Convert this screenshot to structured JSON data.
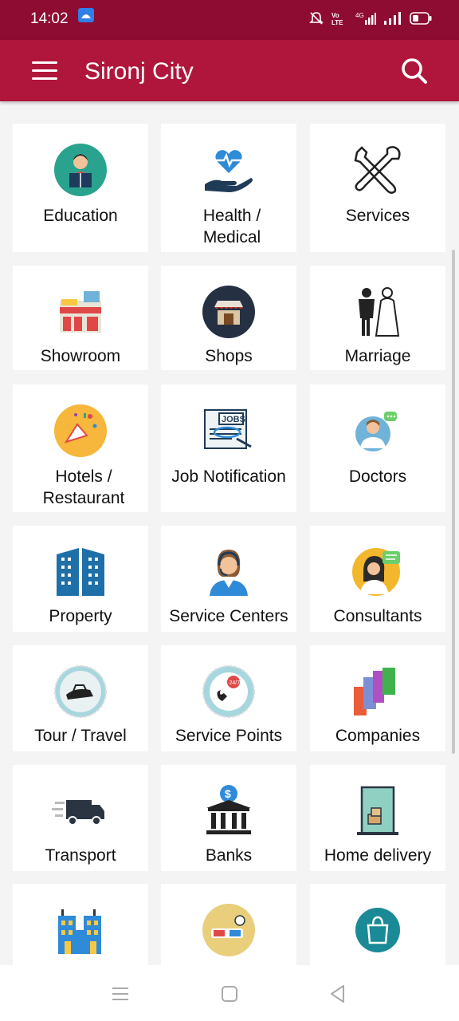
{
  "status": {
    "time": "14:02",
    "network": "4G"
  },
  "app": {
    "title": "Sironj City"
  },
  "categories": [
    {
      "label": "Education",
      "icon": "education-icon"
    },
    {
      "label": "Health / Medical",
      "icon": "health-icon"
    },
    {
      "label": "Services",
      "icon": "tools-icon"
    },
    {
      "label": "Showroom",
      "icon": "showroom-icon"
    },
    {
      "label": "Shops",
      "icon": "shop-icon"
    },
    {
      "label": "Marriage",
      "icon": "marriage-icon"
    },
    {
      "label": "Hotels / Restaurant",
      "icon": "party-icon"
    },
    {
      "label": "Job Notification",
      "icon": "jobs-newspaper-icon"
    },
    {
      "label": "Doctors",
      "icon": "doctor-icon"
    },
    {
      "label": "Property",
      "icon": "building-icon"
    },
    {
      "label": "Service Centers",
      "icon": "support-agent-icon"
    },
    {
      "label": "Consultants",
      "icon": "consultant-icon"
    },
    {
      "label": "Tour / Travel",
      "icon": "travel-icon"
    },
    {
      "label": "Service Points",
      "icon": "service-point-icon"
    },
    {
      "label": "Companies",
      "icon": "companies-icon"
    },
    {
      "label": "Transport",
      "icon": "truck-icon"
    },
    {
      "label": "Banks",
      "icon": "bank-icon"
    },
    {
      "label": "Home delivery",
      "icon": "home-delivery-icon"
    },
    {
      "label": "",
      "icon": "city-buildings-icon"
    },
    {
      "label": "",
      "icon": "3d-glasses-icon"
    },
    {
      "label": "",
      "icon": "shopping-bag-icon"
    }
  ]
}
